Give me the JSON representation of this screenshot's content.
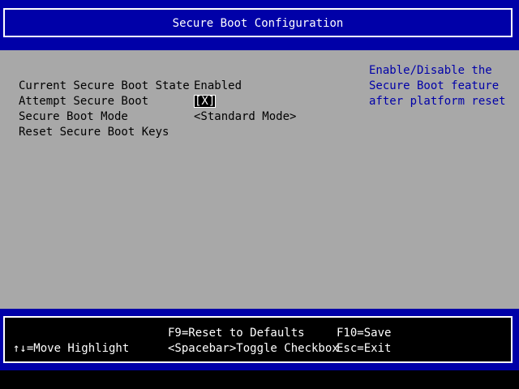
{
  "header": {
    "title": "Secure Boot Configuration"
  },
  "settings": [
    {
      "label": "Current Secure Boot State",
      "value": "Enabled"
    },
    {
      "label": "Attempt Secure Boot",
      "value": "[X]"
    },
    {
      "label": "Secure Boot Mode",
      "value": "<Standard Mode>"
    },
    {
      "label": "Reset Secure Boot Keys",
      "value": ""
    }
  ],
  "help": {
    "lines": [
      "Enable/Disable the",
      "Secure Boot feature",
      "after platform reset"
    ]
  },
  "footer": {
    "move_highlight": "↑↓=Move Highlight",
    "reset_defaults": "F9=Reset to Defaults",
    "save": "F10=Save",
    "toggle_checkbox": "<Spacebar>Toggle Checkbox",
    "exit": "Esc=Exit"
  },
  "colors": {
    "header_bg": "#0000a8",
    "panel_bg": "#a8a8a8",
    "help_text": "#0000a8",
    "footer_bg": "#000000",
    "text_white": "#ffffff"
  }
}
